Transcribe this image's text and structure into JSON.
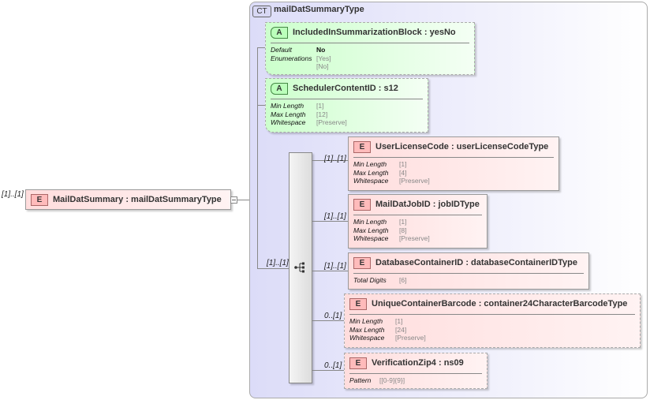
{
  "root": {
    "occurrence": "[1]..[1]",
    "badge": "E",
    "name": "MailDatSummary",
    "type": "mailDatSummaryType"
  },
  "complex_type": {
    "badge": "CT",
    "name": "mailDatSummaryType"
  },
  "attributes": [
    {
      "badge": "A",
      "name": "IncludedInSummarizationBlock",
      "type": "yesNo",
      "props": [
        {
          "k": "Default",
          "v": "No"
        },
        {
          "k": "Enumerations",
          "v": "[Yes]"
        },
        {
          "k": "",
          "v": "[No]"
        }
      ]
    },
    {
      "badge": "A",
      "name": "SchedulerContentID",
      "type": "s12",
      "props": [
        {
          "k": "Min Length",
          "v": "[1]"
        },
        {
          "k": "Max Length",
          "v": "[12]"
        },
        {
          "k": "Whitespace",
          "v": "[Preserve]"
        }
      ]
    }
  ],
  "sequence": {
    "occurrence": "[1]..[1]"
  },
  "elements": [
    {
      "occurrence": "[1]..[1]",
      "badge": "E",
      "name": "UserLicenseCode",
      "type": "userLicenseCodeType",
      "props": [
        {
          "k": "Min Length",
          "v": "[1]"
        },
        {
          "k": "Max Length",
          "v": "[4]"
        },
        {
          "k": "Whitespace",
          "v": "[Preserve]"
        }
      ]
    },
    {
      "occurrence": "[1]..[1]",
      "badge": "E",
      "name": "MailDatJobID",
      "type": "jobIDType",
      "props": [
        {
          "k": "Min Length",
          "v": "[1]"
        },
        {
          "k": "Max Length",
          "v": "[8]"
        },
        {
          "k": "Whitespace",
          "v": "[Preserve]"
        }
      ]
    },
    {
      "occurrence": "[1]..[1]",
      "badge": "E",
      "name": "DatabaseContainerID",
      "type": "databaseContainerIDType",
      "props": [
        {
          "k": "Total Digits",
          "v": "[6]"
        }
      ]
    },
    {
      "occurrence": "0..[1]",
      "badge": "E",
      "name": "UniqueContainerBarcode",
      "type": "container24CharacterBarcodeType",
      "props": [
        {
          "k": "Min Length",
          "v": "[1]"
        },
        {
          "k": "Max Length",
          "v": "[24]"
        },
        {
          "k": "Whitespace",
          "v": "[Preserve]"
        }
      ]
    },
    {
      "occurrence": "0..[1]",
      "badge": "E",
      "name": "VerificationZip4",
      "type": "ns09",
      "props": [
        {
          "k": "Pattern",
          "v": "[[0-9]{9}]"
        }
      ]
    }
  ]
}
